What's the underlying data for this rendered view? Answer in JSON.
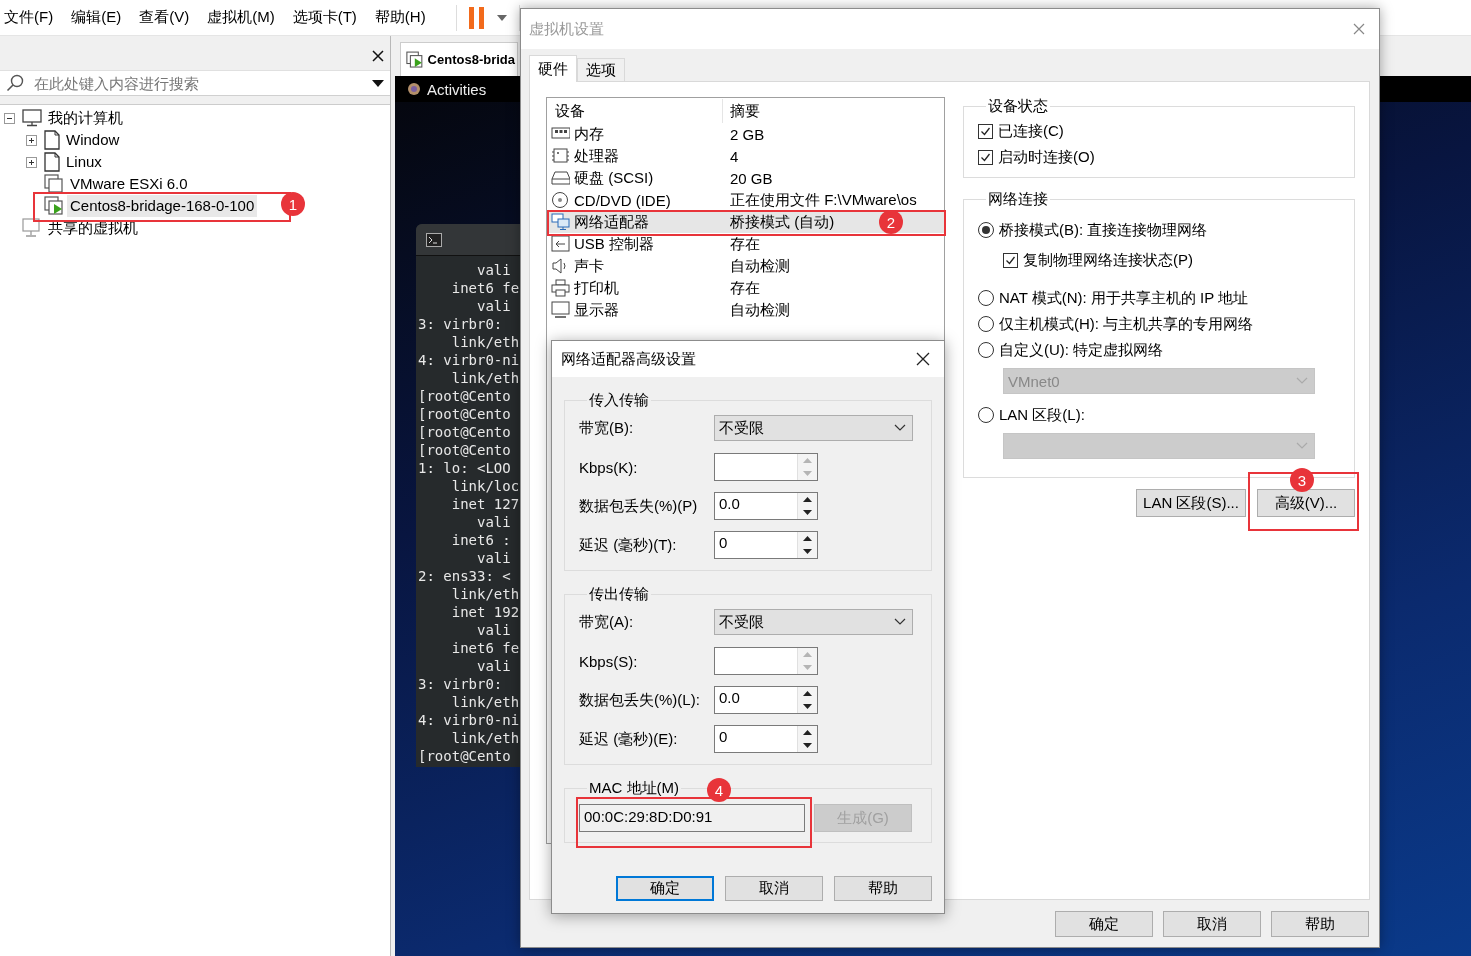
{
  "menu_bar": {
    "items": [
      "文件(F)",
      "编辑(E)",
      "查看(V)",
      "虚拟机(M)",
      "选项卡(T)",
      "帮助(H)"
    ]
  },
  "library": {
    "search": {
      "placeholder": "在此处键入内容进行搜索"
    },
    "tree": [
      {
        "label": "我的计算机",
        "kind": "computer",
        "expanded": true,
        "selected": false,
        "children": [
          {
            "label": "Window",
            "kind": "folder",
            "expanded": false,
            "selected": false
          },
          {
            "label": "Linux",
            "kind": "folder",
            "expanded": false,
            "selected": false
          },
          {
            "label": "VMware ESXi 6.0",
            "kind": "vm",
            "running": false,
            "selected": false
          },
          {
            "label": "Centos8-bridage-168-0-100",
            "kind": "vm",
            "running": true,
            "selected": true
          }
        ]
      },
      {
        "label": "共享的虚拟机",
        "kind": "shared",
        "selected": false
      }
    ]
  },
  "vm_tab": {
    "title": "Centos8-brida"
  },
  "guest": {
    "activities": "Activities",
    "terminal_lines": [
      {
        "kind": "value",
        "text": "vali"
      },
      {
        "kind": "detail",
        "text": "inet6 fe"
      },
      {
        "kind": "value",
        "text": "vali"
      },
      {
        "kind": "head",
        "text": "3: virbr0:"
      },
      {
        "kind": "detail",
        "text": "link/eth"
      },
      {
        "kind": "head",
        "text": "4: virbr0-ni"
      },
      {
        "kind": "detail",
        "text": "link/eth"
      },
      {
        "kind": "head",
        "text": "[root@Cento"
      },
      {
        "kind": "head",
        "text": "[root@Cento"
      },
      {
        "kind": "head",
        "text": "[root@Cento"
      },
      {
        "kind": "head",
        "text": "[root@Cento"
      },
      {
        "kind": "head",
        "text": "1: lo: <LOO"
      },
      {
        "kind": "detail",
        "text": "link/loc"
      },
      {
        "kind": "detail",
        "text": "inet 127"
      },
      {
        "kind": "value",
        "text": "vali"
      },
      {
        "kind": "detail",
        "text": "inet6 :"
      },
      {
        "kind": "value",
        "text": "vali"
      },
      {
        "kind": "head",
        "text": "2: ens33: <"
      },
      {
        "kind": "detail",
        "text": "link/eth"
      },
      {
        "kind": "detail",
        "text": "inet 192"
      },
      {
        "kind": "value",
        "text": "vali"
      },
      {
        "kind": "detail",
        "text": "inet6 fe"
      },
      {
        "kind": "value",
        "text": "vali"
      },
      {
        "kind": "head",
        "text": "3: virbr0:"
      },
      {
        "kind": "detail",
        "text": "link/eth"
      },
      {
        "kind": "head",
        "text": "4: virbr0-ni"
      },
      {
        "kind": "detail",
        "text": "link/eth"
      },
      {
        "kind": "head",
        "text": "[root@Cento"
      }
    ]
  },
  "settings_dialog": {
    "title": "虚拟机设置",
    "tabs": [
      {
        "label": "硬件",
        "selected": true
      },
      {
        "label": "选项",
        "selected": false
      }
    ],
    "devices": {
      "columns": [
        "设备",
        "摘要"
      ],
      "rows": [
        {
          "kind": "memory",
          "device": "内存",
          "summary": "2 GB",
          "selected": false
        },
        {
          "kind": "cpu",
          "device": "处理器",
          "summary": "4",
          "selected": false
        },
        {
          "kind": "disk",
          "device": "硬盘 (SCSI)",
          "summary": "20 GB",
          "selected": false
        },
        {
          "kind": "cdrom",
          "device": "CD/DVD (IDE)",
          "summary": "正在使用文件 F:\\VMware\\os",
          "selected": false
        },
        {
          "kind": "network",
          "device": "网络适配器",
          "summary": "桥接模式 (自动)",
          "selected": true
        },
        {
          "kind": "usb",
          "device": "USB 控制器",
          "summary": "存在",
          "selected": false
        },
        {
          "kind": "sound",
          "device": "声卡",
          "summary": "自动检测",
          "selected": false
        },
        {
          "kind": "printer",
          "device": "打印机",
          "summary": "存在",
          "selected": false
        },
        {
          "kind": "display",
          "device": "显示器",
          "summary": "自动检测",
          "selected": false
        }
      ]
    },
    "device_status": {
      "title": "设备状态",
      "options": [
        {
          "label": "已连接(C)",
          "checked": true
        },
        {
          "label": "启动时连接(O)",
          "checked": true
        }
      ]
    },
    "network": {
      "title": "网络连接",
      "options": [
        {
          "kind": "radio",
          "label": "桥接模式(B): 直接连接物理网络",
          "selected": true
        },
        {
          "kind": "checkbox",
          "label": "复制物理网络连接状态(P)",
          "checked": true
        },
        {
          "kind": "radio",
          "label": "NAT 模式(N): 用于共享主机的 IP 地址",
          "selected": false
        },
        {
          "kind": "radio",
          "label": "仅主机模式(H): 与主机共享的专用网络",
          "selected": false
        },
        {
          "kind": "radio",
          "label": "自定义(U): 特定虚拟网络",
          "selected": false
        },
        {
          "kind": "select",
          "value": "VMnet0",
          "disabled": true
        },
        {
          "kind": "radio",
          "label": "LAN 区段(L):",
          "selected": false
        },
        {
          "kind": "select",
          "disabled": true
        }
      ],
      "buttons": [
        "LAN 区段(S)...",
        "高级(V)..."
      ]
    },
    "buttons": [
      "确定",
      "取消",
      "帮助"
    ]
  },
  "advanced_dialog": {
    "title": "网络适配器高级设置",
    "groups": [
      {
        "title": "传入传输",
        "rows": [
          {
            "kind": "select",
            "label": "带宽(B):",
            "value": "不受限"
          },
          {
            "kind": "spin",
            "label": "Kbps(K):",
            "disabled": true
          },
          {
            "kind": "spin",
            "label": "数据包丢失(%)(P)",
            "value": "0.0",
            "disabled": false
          },
          {
            "kind": "spin",
            "label": "延迟 (毫秒)(T):",
            "value": "0",
            "disabled": false
          }
        ]
      },
      {
        "title": "传出传输",
        "rows": [
          {
            "kind": "select",
            "label": "带宽(A):",
            "value": "不受限"
          },
          {
            "kind": "spin",
            "label": "Kbps(S):",
            "disabled": true
          },
          {
            "kind": "spin",
            "label": "数据包丢失(%)(L):",
            "value": "0.0",
            "disabled": false
          },
          {
            "kind": "spin",
            "label": "延迟 (毫秒)(E):",
            "value": "0",
            "disabled": false
          }
        ]
      }
    ],
    "mac": {
      "title": "MAC 地址(M)",
      "value": "00:0C:29:8D:D0:91",
      "button": {
        "label": "生成(G)",
        "disabled": true
      }
    },
    "buttons": [
      {
        "label": "确定",
        "default": true
      },
      {
        "label": "取消",
        "default": false
      },
      {
        "label": "帮助",
        "default": false
      }
    ]
  },
  "annotations": [
    {
      "number": "1"
    },
    {
      "number": "2"
    },
    {
      "number": "3"
    },
    {
      "number": "4"
    }
  ]
}
